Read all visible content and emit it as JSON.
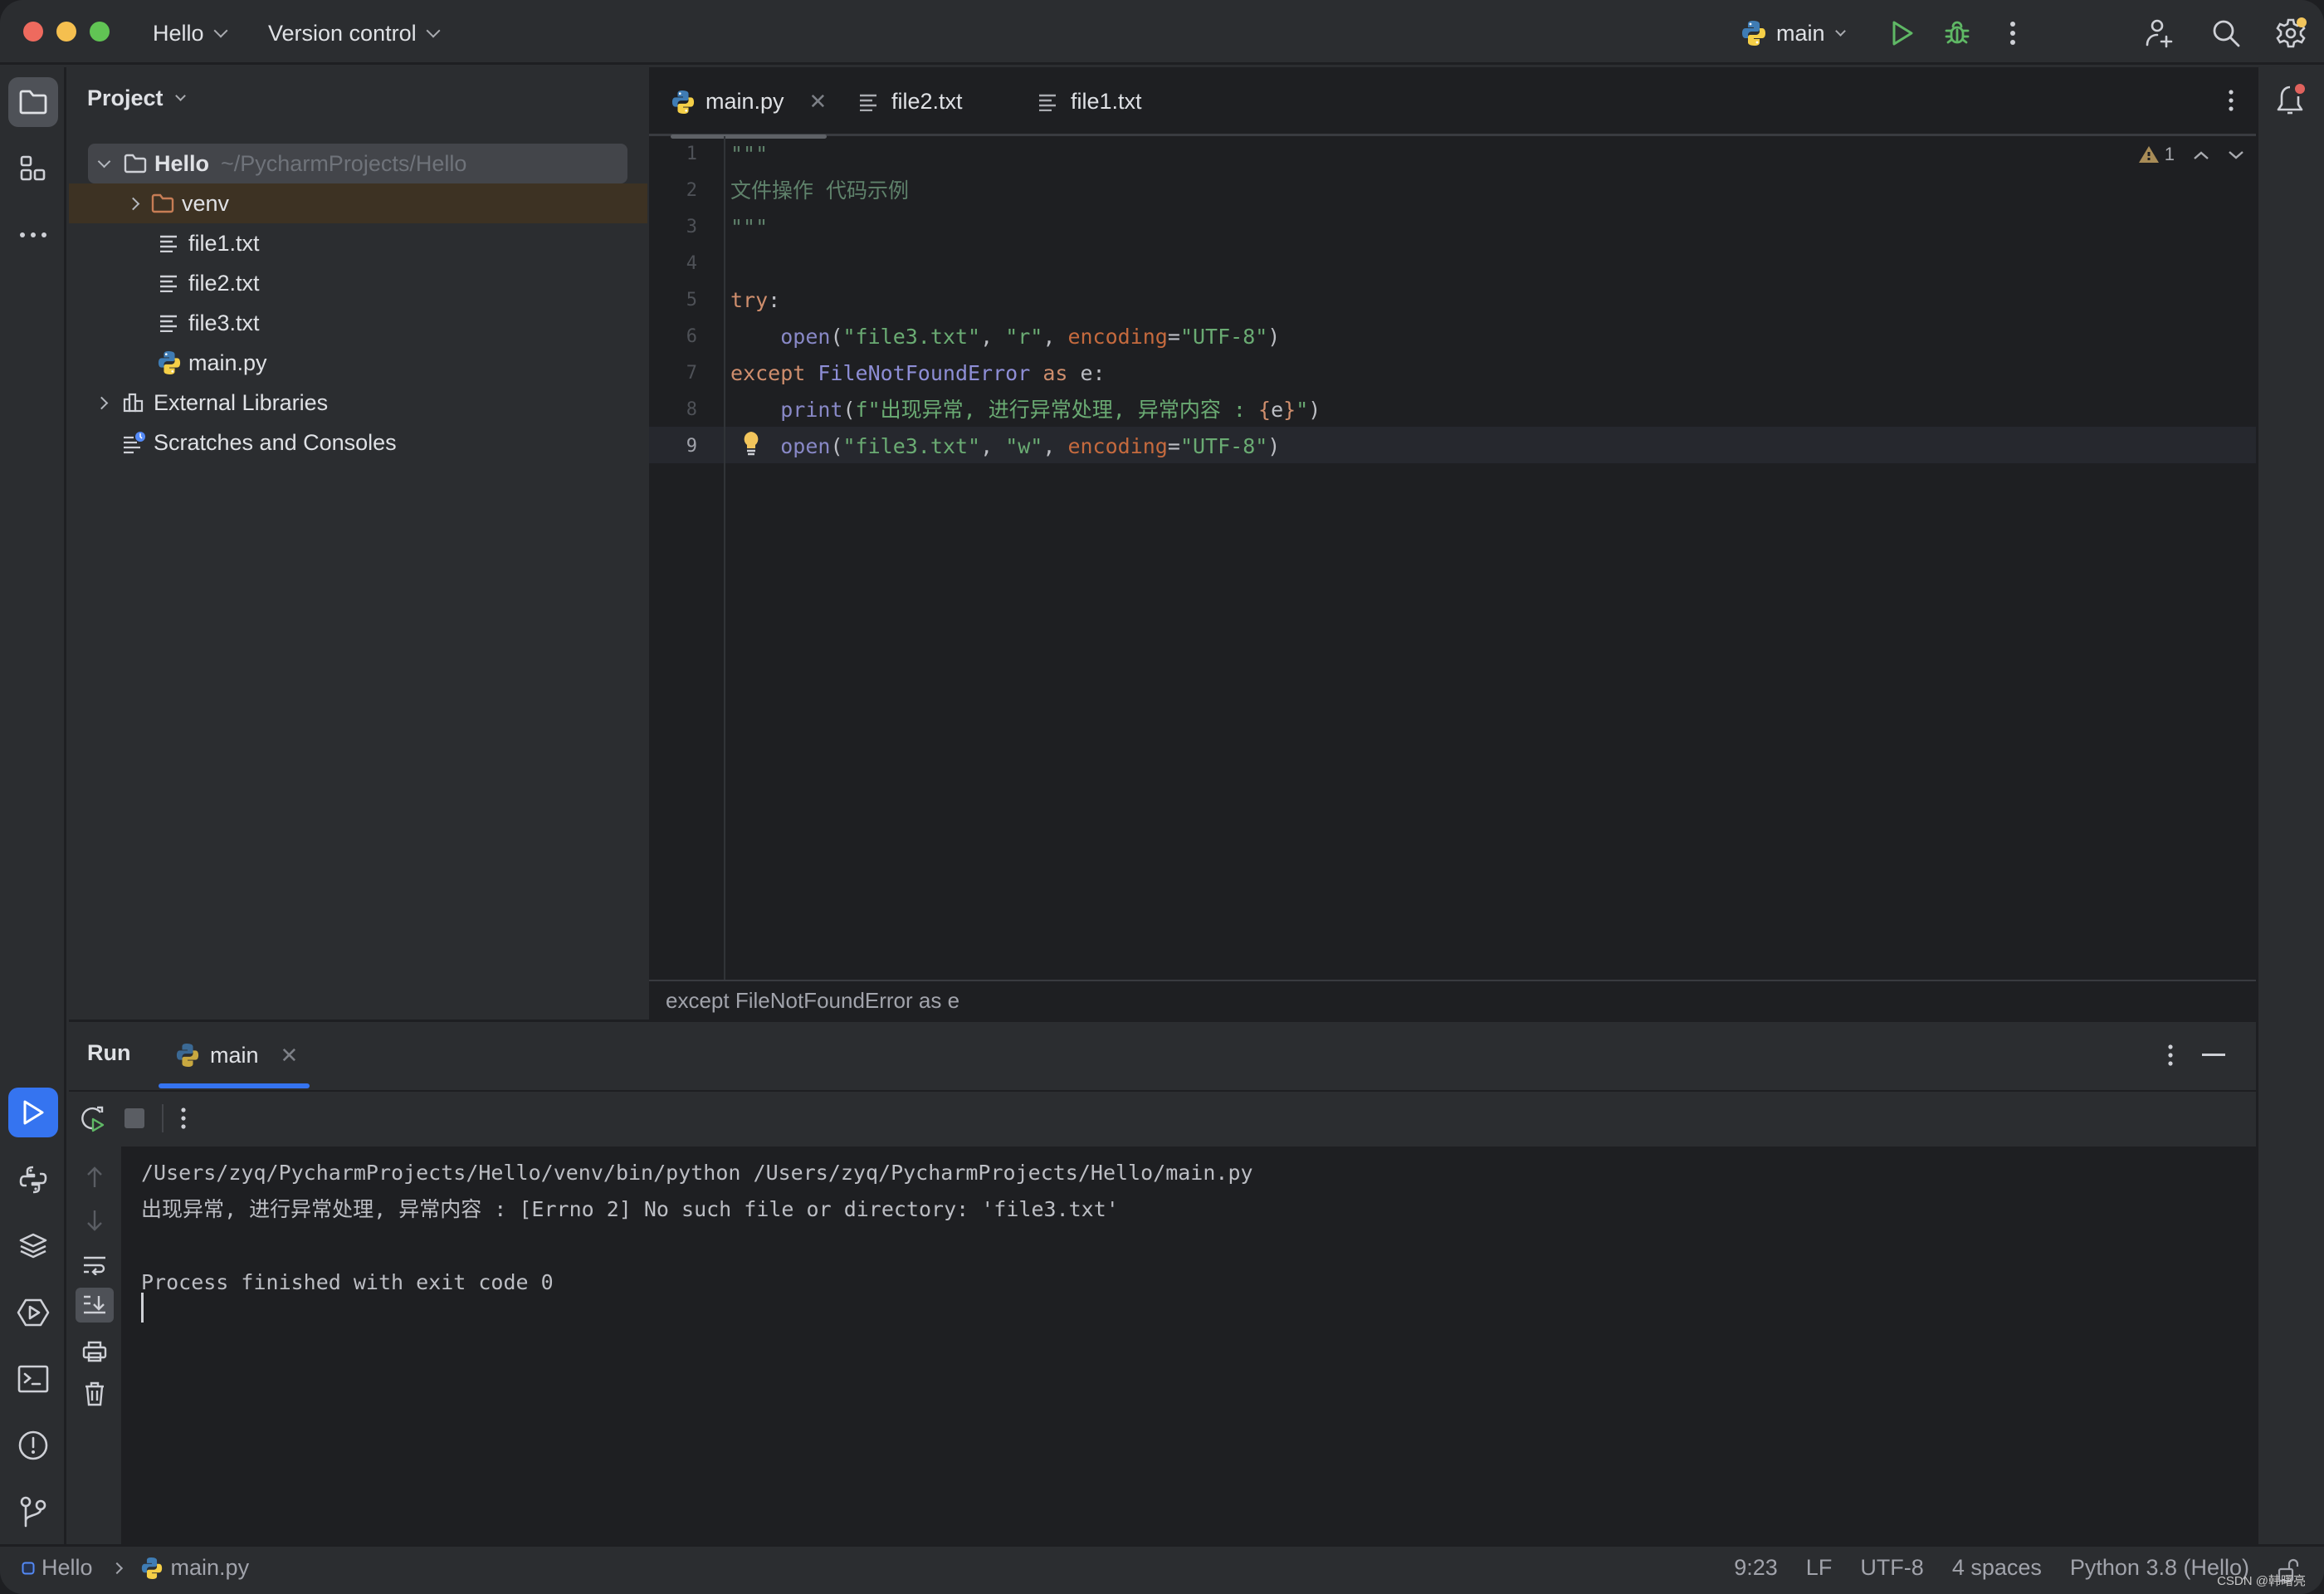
{
  "titlebar": {
    "project_menu": "Hello",
    "vcs_menu": "Version control",
    "run_config": "main"
  },
  "project_panel": {
    "title": "Project",
    "tree": [
      {
        "label": "Hello",
        "path_hint": "~/PycharmProjects/Hello",
        "type": "folder",
        "expanded": true,
        "level": 0
      },
      {
        "label": "venv",
        "type": "excluded-folder",
        "expanded": false,
        "level": 1
      },
      {
        "label": "file1.txt",
        "type": "text-file",
        "level": 1
      },
      {
        "label": "file2.txt",
        "type": "text-file",
        "level": 1
      },
      {
        "label": "file3.txt",
        "type": "text-file",
        "level": 1
      },
      {
        "label": "main.py",
        "type": "python-file",
        "level": 1
      },
      {
        "label": "External Libraries",
        "type": "library",
        "expanded": false,
        "level": 0
      },
      {
        "label": "Scratches and Consoles",
        "type": "scratches",
        "level": 0
      }
    ]
  },
  "editor": {
    "tabs": [
      {
        "label": "main.py",
        "icon": "python-icon",
        "active": true,
        "closable": true
      },
      {
        "label": "file2.txt",
        "icon": "text-file-icon",
        "active": false
      },
      {
        "label": "file1.txt",
        "icon": "text-file-icon",
        "active": false
      }
    ],
    "line_numbers": [
      "1",
      "2",
      "3",
      "4",
      "5",
      "6",
      "7",
      "8",
      "9"
    ],
    "current_line": 9,
    "code": {
      "l1": "\"\"\"",
      "l2": "文件操作 代码示例",
      "l3": "\"\"\"",
      "l5_kw": "try",
      "l5_colon": ":",
      "l6_indent": "    ",
      "l6_fn": "open",
      "l6_open": "(",
      "l6_s1": "\"file3.txt\"",
      "l6_c1": ", ",
      "l6_s2": "\"r\"",
      "l6_c2": ", ",
      "l6_param": "encoding",
      "l6_eq": "=",
      "l6_s3": "\"UTF-8\"",
      "l6_close": ")",
      "l7_kw": "except",
      "l7_sp": " ",
      "l7_cls": "FileNotFoundError",
      "l7_sp2": " ",
      "l7_as": "as",
      "l7_rest": " e:",
      "l8_indent": "    ",
      "l8_fn": "print",
      "l8_open": "(",
      "l8_s1": "f\"出现异常, 进行异常处理, 异常内容 : ",
      "l8_b1": "{",
      "l8_var": "e",
      "l8_b2": "}",
      "l8_s2": "\"",
      "l8_close": ")",
      "l9_indent": "    ",
      "l9_fn": "open",
      "l9_open": "(",
      "l9_s1": "\"file3.txt\"",
      "l9_c1": ", ",
      "l9_s2": "\"w\"",
      "l9_c2": ", ",
      "l9_param": "encoding",
      "l9_eq": "=",
      "l9_s3": "\"UTF-8\"",
      "l9_close": ")"
    },
    "inspection": {
      "warnings": "1"
    },
    "breadcrumb": "except FileNotFoundError as e"
  },
  "run_panel": {
    "title": "Run",
    "tab_label": "main",
    "console_lines": [
      "/Users/zyq/PycharmProjects/Hello/venv/bin/python /Users/zyq/PycharmProjects/Hello/main.py",
      "出现异常, 进行异常处理, 异常内容 : [Errno 2] No such file or directory: 'file3.txt'",
      "",
      "Process finished with exit code 0"
    ]
  },
  "statusbar": {
    "project": "Hello",
    "file": "main.py",
    "position": "9:23",
    "line_separator": "LF",
    "encoding": "UTF-8",
    "indent": "4 spaces",
    "interpreter": "Python 3.8 (Hello)",
    "watermark": "CSDN @韩曙亮"
  },
  "colors": {
    "accent": "#3574f0",
    "run_green": "#5fb865",
    "warning": "#a88c57",
    "notification_dot": "#e0625d",
    "settings_dot": "#f2c55c"
  }
}
